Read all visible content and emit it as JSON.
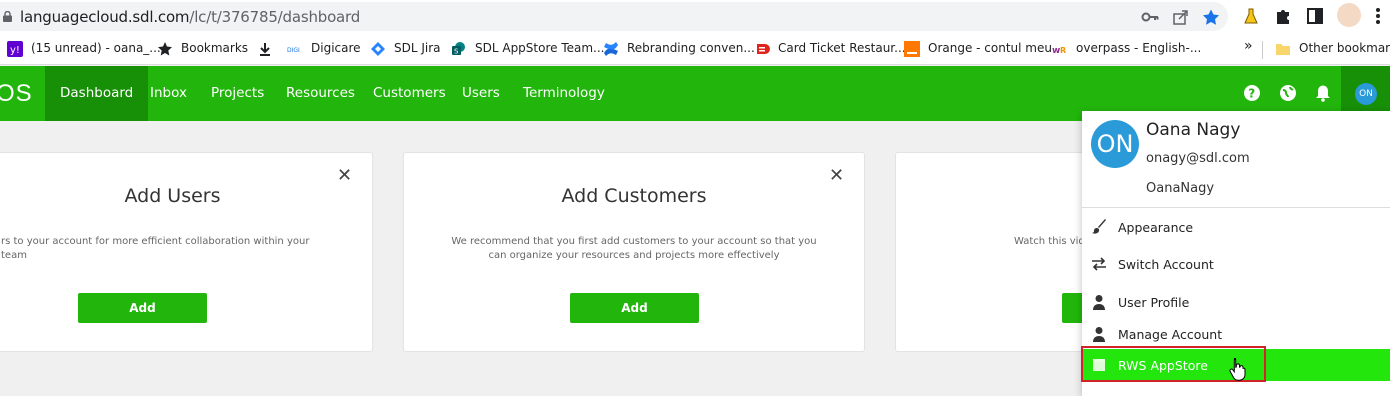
{
  "browser": {
    "url_host": "languagecloud.sdl.com",
    "url_path": "/lc/t/376785/dashboard",
    "bookmarks": [
      {
        "label": "(15 unread) - oana_...",
        "icon": "yahoo-mail-icon"
      },
      {
        "label": "Bookmarks",
        "icon": "star-icon"
      },
      {
        "label": "",
        "icon": "download-icon"
      },
      {
        "label": "Digicare",
        "icon": "digicare-icon"
      },
      {
        "label": "SDL Jira",
        "icon": "jira-icon"
      },
      {
        "label": "SDL AppStore Team...",
        "icon": "sharepoint-icon"
      },
      {
        "label": "Rebranding conven...",
        "icon": "confluence-icon"
      },
      {
        "label": "Card Ticket Restaur...",
        "icon": "edenred-icon"
      },
      {
        "label": "Orange - contul meu",
        "icon": "orange-icon"
      },
      {
        "label": "overpass - English-...",
        "icon": "wordreference-icon"
      }
    ],
    "overflow": "»",
    "other_bookmarks": "Other bookmarks"
  },
  "app": {
    "brand": "OS",
    "nav": [
      "Dashboard",
      "Inbox",
      "Projects",
      "Resources",
      "Customers",
      "Users",
      "Terminology"
    ],
    "active_nav": "Dashboard",
    "user_initials": "ON"
  },
  "cards": [
    {
      "title": "Add Users",
      "desc": "rs to your account for more efficient collaboration within your team",
      "button": "Add",
      "close": "✕"
    },
    {
      "title": "Add Customers",
      "desc": "We recommend that you first add customers to your account so that you can organize your resources and projects more effectively",
      "button": "Add",
      "close": "✕"
    },
    {
      "title": "",
      "desc": "Watch this vid",
      "button": "",
      "close": ""
    }
  ],
  "user_menu": {
    "initials": "ON",
    "name": "Oana Nagy",
    "email": "onagy@sdl.com",
    "username": "OanaNagy",
    "items": [
      {
        "label": "Appearance",
        "icon": "paintbrush-icon"
      },
      {
        "label": "Switch Account",
        "icon": "swap-arrows-icon"
      },
      {
        "label": "User Profile",
        "icon": "user-icon"
      },
      {
        "label": "Manage Account",
        "icon": "user-icon"
      },
      {
        "label": "RWS AppStore",
        "icon": "appstore-icon"
      }
    ],
    "highlighted": "RWS AppStore"
  },
  "colors": {
    "nav_green": "#22b60c",
    "nav_active": "#179008",
    "highlight_green": "#22e60c",
    "avatar_blue": "#2a9ad8",
    "annotation_red": "#d0232a"
  }
}
